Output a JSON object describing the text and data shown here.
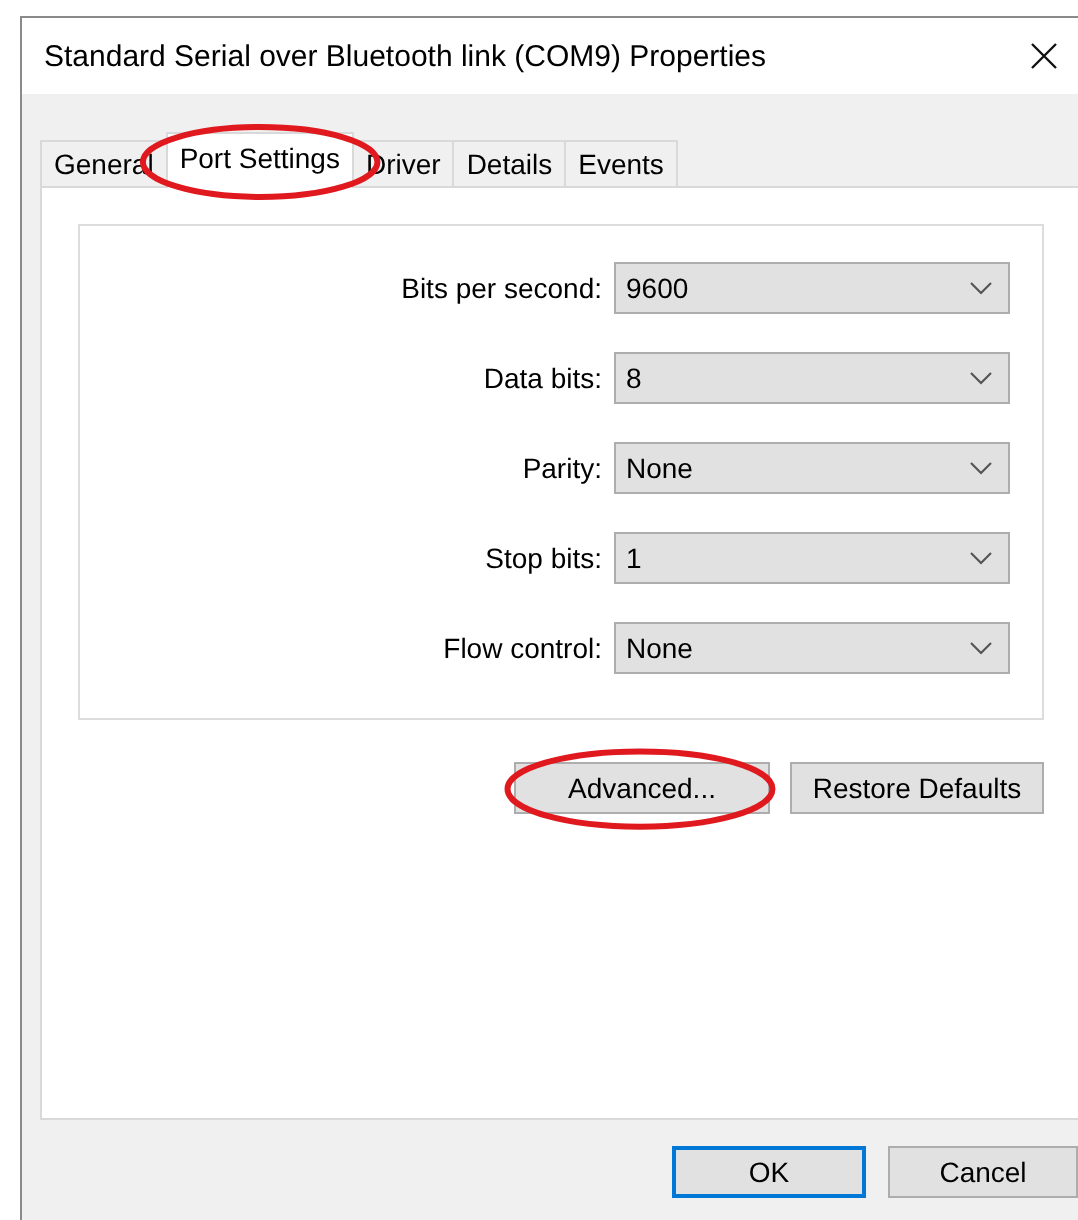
{
  "window": {
    "title": "Standard Serial over Bluetooth link (COM9) Properties"
  },
  "tabs": [
    {
      "label": "General",
      "selected": false,
      "highlighted": false
    },
    {
      "label": "Port Settings",
      "selected": true,
      "highlighted": true
    },
    {
      "label": "Driver",
      "selected": false,
      "highlighted": false
    },
    {
      "label": "Details",
      "selected": false,
      "highlighted": false
    },
    {
      "label": "Events",
      "selected": false,
      "highlighted": false
    }
  ],
  "settings": [
    {
      "label": "Bits per second:",
      "value": "9600"
    },
    {
      "label": "Data bits:",
      "value": "8"
    },
    {
      "label": "Parity:",
      "value": "None"
    },
    {
      "label": "Stop bits:",
      "value": "1"
    },
    {
      "label": "Flow control:",
      "value": "None"
    }
  ],
  "panel_buttons": [
    {
      "label": "Advanced...",
      "highlighted": true
    },
    {
      "label": "Restore Defaults",
      "highlighted": false
    }
  ],
  "dialog_buttons": [
    {
      "label": "OK",
      "default": true
    },
    {
      "label": "Cancel",
      "default": false
    }
  ]
}
